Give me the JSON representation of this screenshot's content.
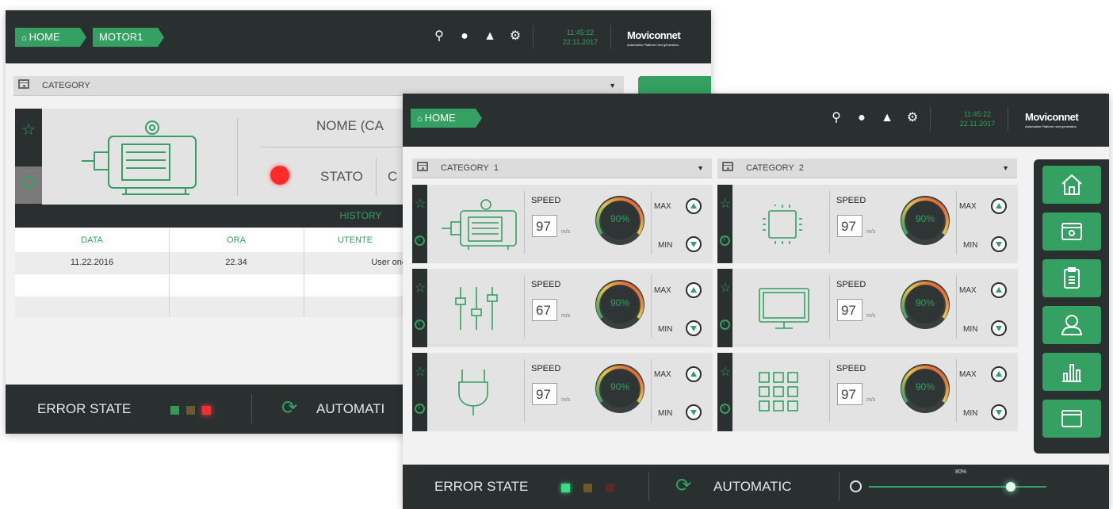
{
  "colors": {
    "accent": "#34a061",
    "dark": "#2a3030",
    "panel": "#e3e3e3",
    "led_green": "#3ddc84",
    "led_brown": "#6b5a2e",
    "led_red": "#ff2a2a"
  },
  "back_window": {
    "breadcrumbs": [
      "HOME",
      "MOTOR1"
    ],
    "clock": {
      "time": "11:45:22",
      "date": "22.11.2017"
    },
    "brand": "Moviconnet",
    "brand_sub": "Automation Platform next generation",
    "category": "CATEGORY",
    "name_label": "NOME (CA",
    "status_label": "STATO",
    "status_extra": "C",
    "history": {
      "title": "HISTORY",
      "columns": [
        "DATA",
        "ORA",
        "UTENTE"
      ],
      "rows": [
        [
          "11.22.2016",
          "22.34",
          "User one"
        ]
      ]
    },
    "error_state": "ERROR STATE",
    "automatic": "AUTOMATI"
  },
  "front_window": {
    "breadcrumbs": [
      "HOME"
    ],
    "clock": {
      "time": "11:45:22",
      "date": "22.11.2017"
    },
    "brand": "Moviconnet",
    "brand_sub": "Automation Platform next generation",
    "categories": [
      {
        "label": "CATEGORY",
        "index": "1"
      },
      {
        "label": "CATEGORY",
        "index": "2"
      }
    ],
    "cards": [
      {
        "device": "motor-icon",
        "speed_label": "SPEED",
        "speed": "97",
        "unit": "m/s",
        "gauge": "90%",
        "max": "MAX",
        "min": "MIN"
      },
      {
        "device": "chip-icon",
        "speed_label": "SPEED",
        "speed": "97",
        "unit": "m/s",
        "gauge": "90%",
        "max": "MAX",
        "min": "MIN"
      },
      {
        "device": "sliders-icon",
        "speed_label": "SPEED",
        "speed": "67",
        "unit": "m/s",
        "gauge": "90%",
        "max": "MAX",
        "min": "MIN"
      },
      {
        "device": "monitor-icon",
        "speed_label": "SPEED",
        "speed": "97",
        "unit": "m/s",
        "gauge": "90%",
        "max": "MAX",
        "min": "MIN"
      },
      {
        "device": "plug-icon",
        "speed_label": "SPEED",
        "speed": "97",
        "unit": "m/s",
        "gauge": "90%",
        "max": "MAX",
        "min": "MIN"
      },
      {
        "device": "grid-icon",
        "speed_label": "SPEED",
        "speed": "97",
        "unit": "m/s",
        "gauge": "90%",
        "max": "MAX",
        "min": "MIN"
      }
    ],
    "nav": [
      "home-icon",
      "category-icon",
      "clipboard-icon",
      "user-icon",
      "chart-icon",
      "window-icon"
    ],
    "error_state": "ERROR STATE",
    "automatic": "AUTOMATIC",
    "progress_label": "80%",
    "progress": 0.8
  }
}
